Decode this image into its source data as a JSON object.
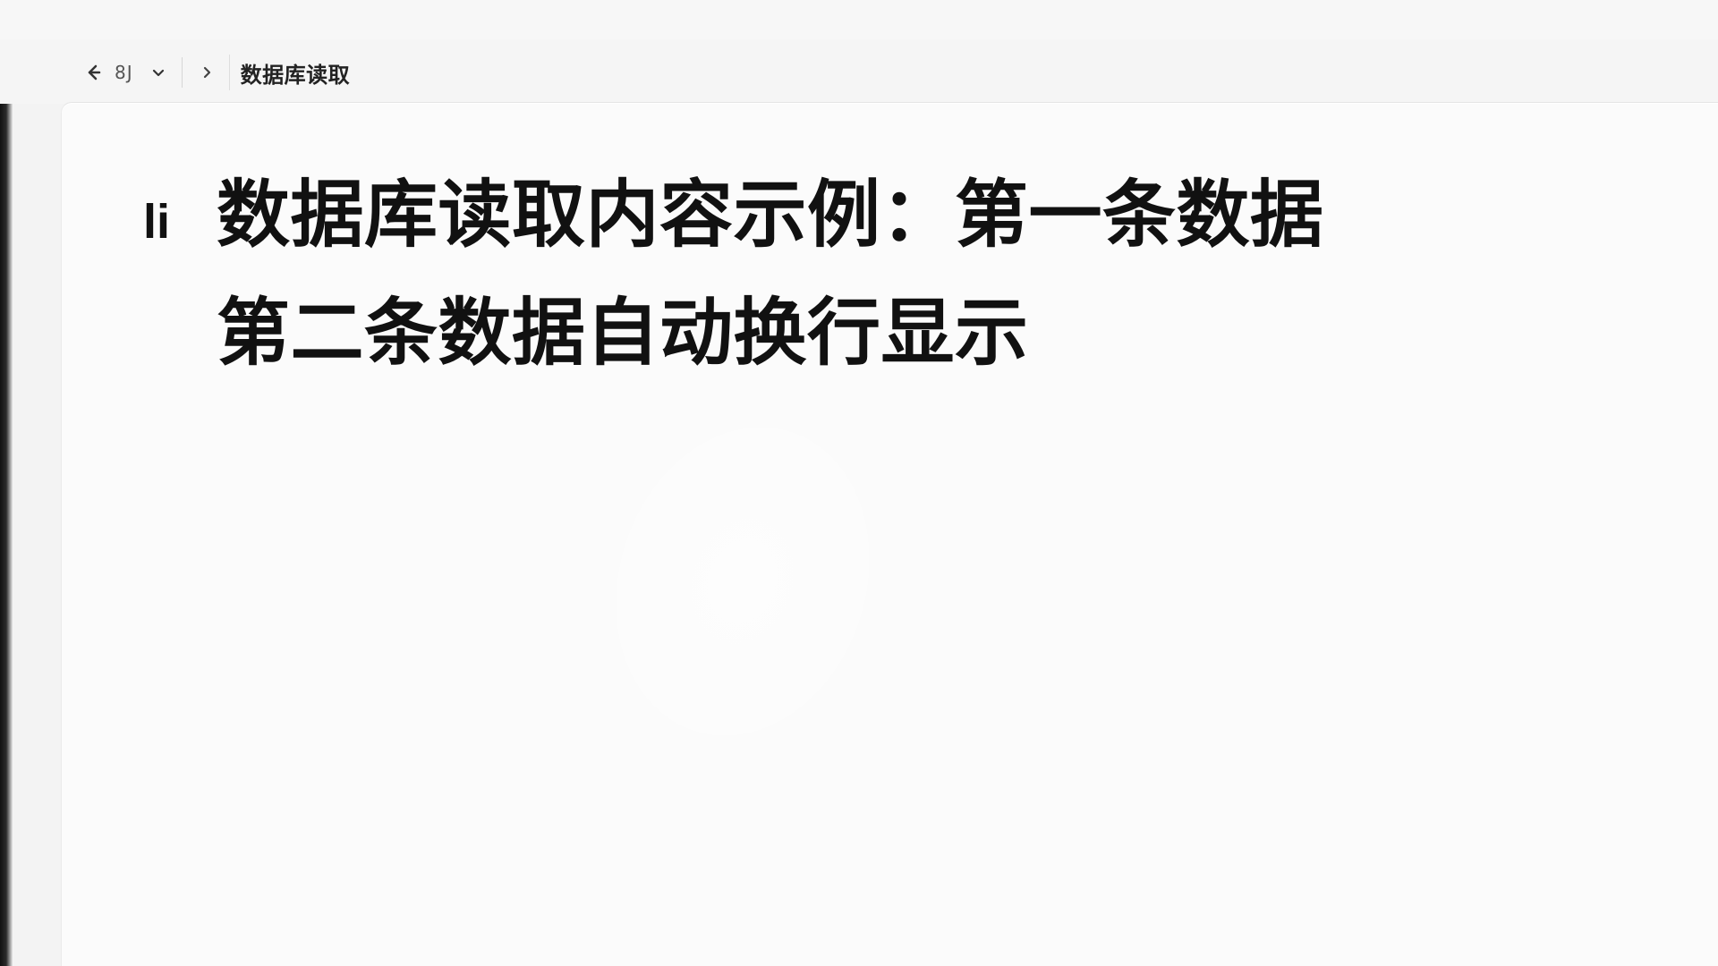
{
  "nav": {
    "recent_label": "8J",
    "breadcrumb": "数据库读取"
  },
  "content": {
    "prefix": "li",
    "line1": "数据库读取内容示例：第一条数据",
    "line2": "第二条数据自动换行显示"
  }
}
